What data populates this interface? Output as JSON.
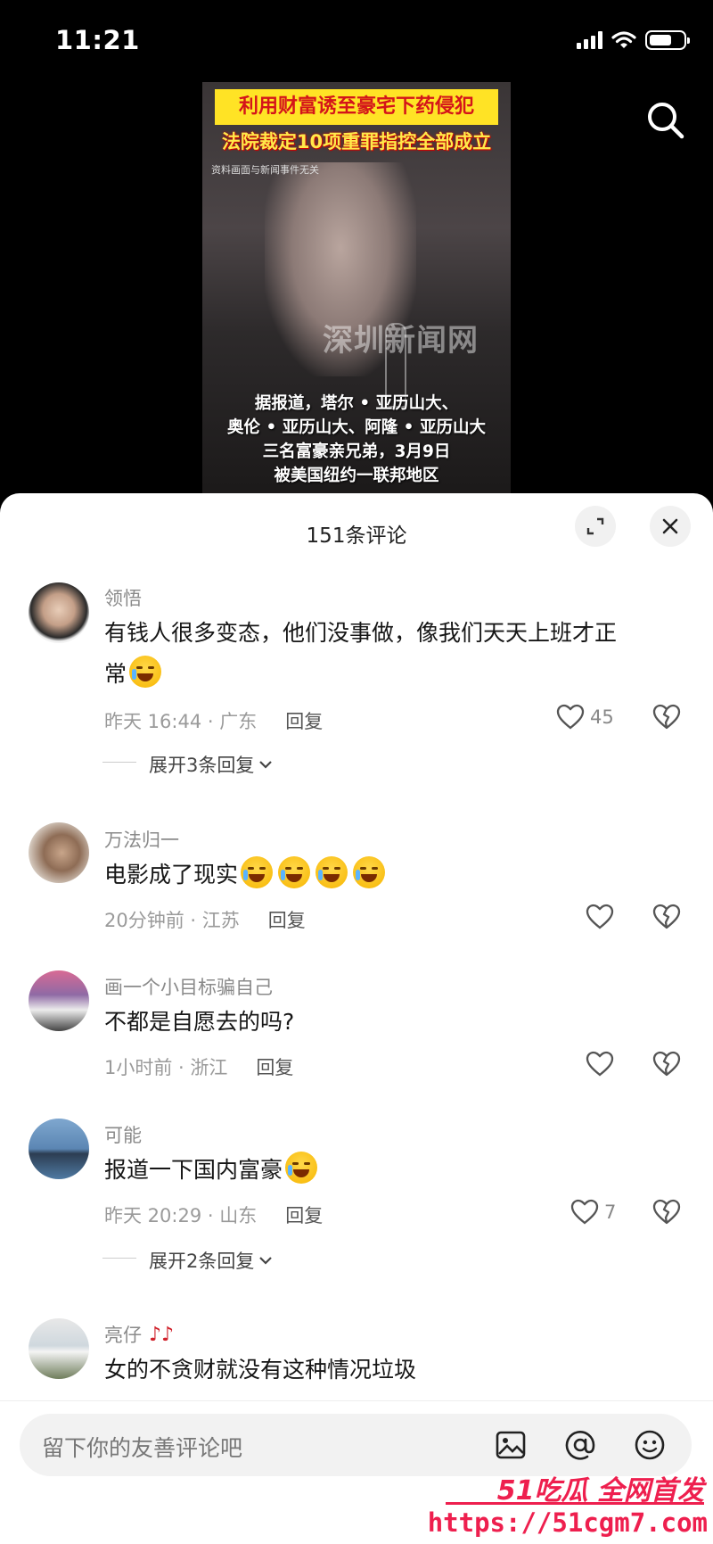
{
  "status_bar": {
    "time": "11:21"
  },
  "video": {
    "headline_top": "利用财富诱至豪宅下药侵犯",
    "headline_sub": "法院裁定10项重罪指控全部成立",
    "disclaimer": "资料画面与新闻事件无关",
    "watermark": "深圳新闻网",
    "caption_lines": [
      "据报道，塔尔 • 亚历山大、",
      "奥伦 • 亚历山大、阿隆 • 亚历山大",
      "三名富豪亲兄弟，3月9日",
      "被美国纽约一联邦地区"
    ]
  },
  "sheet": {
    "title": "151条评论"
  },
  "comments": [
    {
      "name": "领悟",
      "text_line1": "有钱人很多变态，他们没事做，像我们天天上班才正",
      "text_line2": "常",
      "time": "昨天 16:44 · 广东",
      "reply": "回复",
      "likes": "45",
      "expand": "展开3条回复"
    },
    {
      "name": "万法归一",
      "text": "电影成了现实",
      "time": "20分钟前 · 江苏",
      "reply": "回复"
    },
    {
      "name": "画一个小目标骗自己",
      "text": "不都是自愿去的吗?",
      "time": "1小时前 · 浙江",
      "reply": "回复"
    },
    {
      "name": "可能",
      "text": "报道一下国内富豪",
      "time": "昨天 20:29 · 山东",
      "reply": "回复",
      "likes": "7",
      "expand": "展开2条回复"
    },
    {
      "name": "亮仔",
      "text": "女的不贪财就没有这种情况垃圾"
    }
  ],
  "input": {
    "placeholder": "留下你的友善评论吧"
  },
  "promo": {
    "title": "51吃瓜 全网首发",
    "url": "https://51cgm7.com"
  },
  "colors": {
    "accent": "#ee1f4e",
    "headline_bg": "#ffe325",
    "headline_red": "#d4141a"
  },
  "icons": [
    "search-icon",
    "expand-icon",
    "close-icon",
    "heart-icon",
    "broken-heart-icon",
    "image-icon",
    "at-icon",
    "smiley-icon"
  ]
}
